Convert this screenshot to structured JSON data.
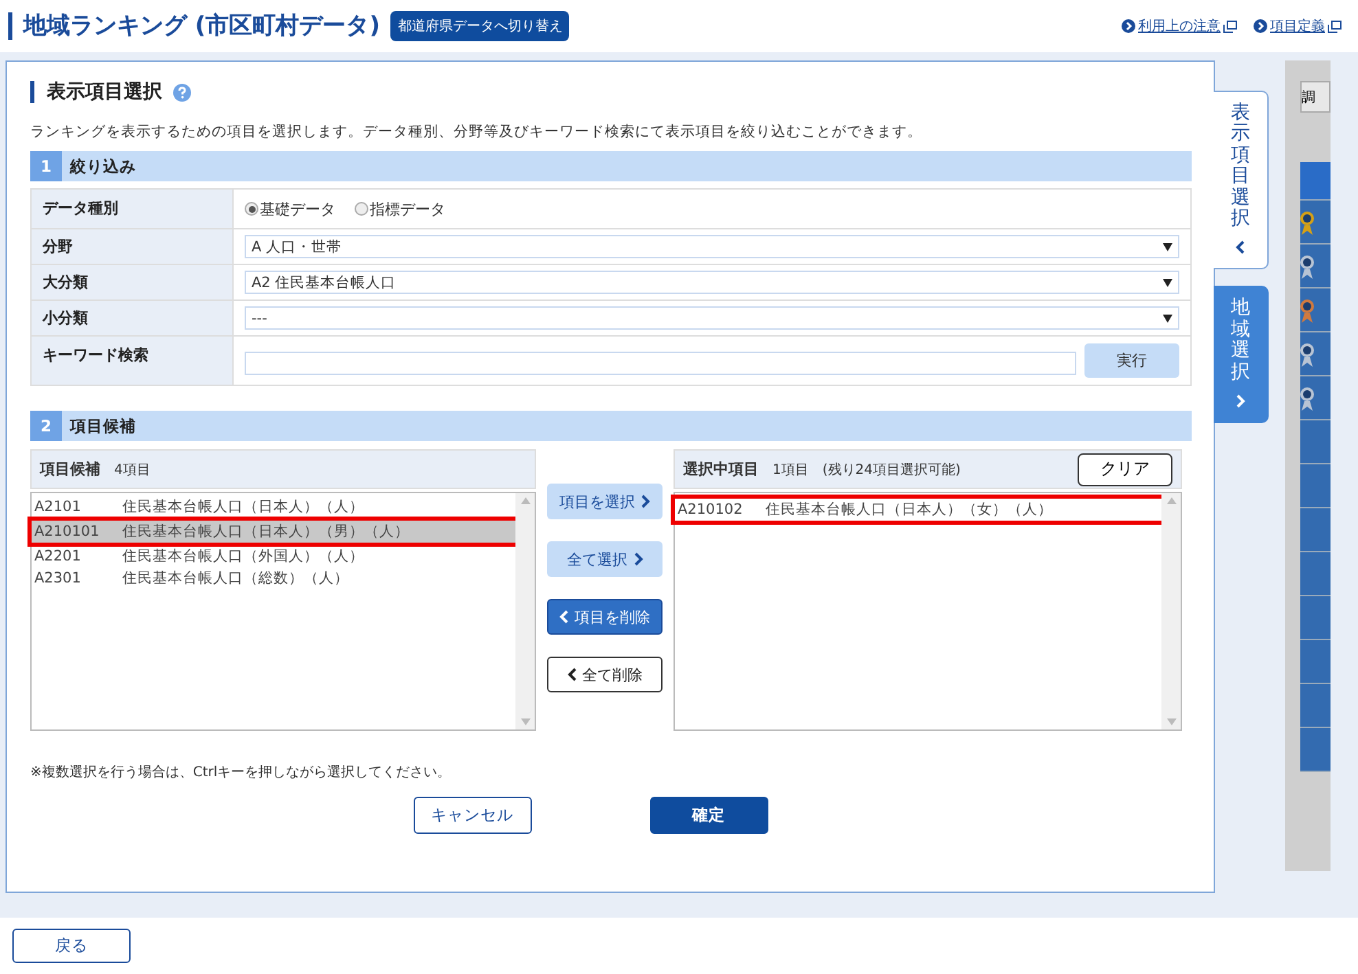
{
  "header": {
    "title": "地域ランキング (市区町村データ)",
    "switch_button": "都道府県データへ切り替え",
    "links": [
      "利用上の注意",
      "項目定義"
    ]
  },
  "panel": {
    "title": "表示項目選択",
    "description": "ランキングを表示するための項目を選択します。データ種別、分野等及びキーワード検索にて表示項目を絞り込むことができます。",
    "filter": {
      "number": "1",
      "title": "絞り込み",
      "rows": [
        {
          "kind": "radio",
          "label": "データ種別",
          "options": [
            {
              "label": "基礎データ",
              "selected": true
            },
            {
              "label": "指標データ",
              "selected": false
            }
          ]
        },
        {
          "kind": "select",
          "label": "分野",
          "value": "A 人口・世帯"
        },
        {
          "kind": "select",
          "label": "大分類",
          "value": "A2 住民基本台帳人口"
        },
        {
          "kind": "select",
          "label": "小分類",
          "value": "---"
        },
        {
          "kind": "search",
          "label": "キーワード検索",
          "button": "実行"
        }
      ]
    },
    "candidates": {
      "number": "2",
      "title": "項目候補",
      "left": {
        "title": "項目候補",
        "count": "4項目",
        "items": [
          {
            "code": "A2101",
            "name": "住民基本台帳人口（日本人）（人）",
            "selected": false,
            "highlighted": false
          },
          {
            "code": "A210101",
            "name": "住民基本台帳人口（日本人）（男）（人）",
            "selected": true,
            "highlighted": true
          },
          {
            "code": "A2201",
            "name": "住民基本台帳人口（外国人）（人）",
            "selected": false,
            "highlighted": false
          },
          {
            "code": "A2301",
            "name": "住民基本台帳人口（総数）（人）",
            "selected": false,
            "highlighted": false
          }
        ]
      },
      "actions": [
        {
          "label": "項目を選択",
          "kind": "add",
          "active": false
        },
        {
          "label": "全て選択",
          "kind": "add",
          "active": false
        },
        {
          "label": "項目を削除",
          "kind": "remove",
          "active": true
        },
        {
          "label": "全て削除",
          "kind": "remove-outline",
          "active": false
        }
      ],
      "right": {
        "title": "選択中項目",
        "count": "1項目",
        "remaining": "(残り24項目選択可能)",
        "clear": "クリア",
        "items": [
          {
            "code": "A210102",
            "name": "住民基本台帳人口（日本人）（女）（人）",
            "selected": false,
            "highlighted": true
          }
        ]
      }
    },
    "note": "※複数選択を行う場合は、Ctrlキーを押しながら選択してください。",
    "buttons": [
      {
        "label": "キャンセル",
        "kind": "secondary"
      },
      {
        "label": "確定",
        "kind": "primary"
      }
    ]
  },
  "side_tabs": [
    {
      "label": "表示項目選択",
      "selected": true
    },
    {
      "label": "地域選択",
      "selected": false
    }
  ],
  "side_strip": {
    "button": "調"
  },
  "back_button": "戻る"
}
